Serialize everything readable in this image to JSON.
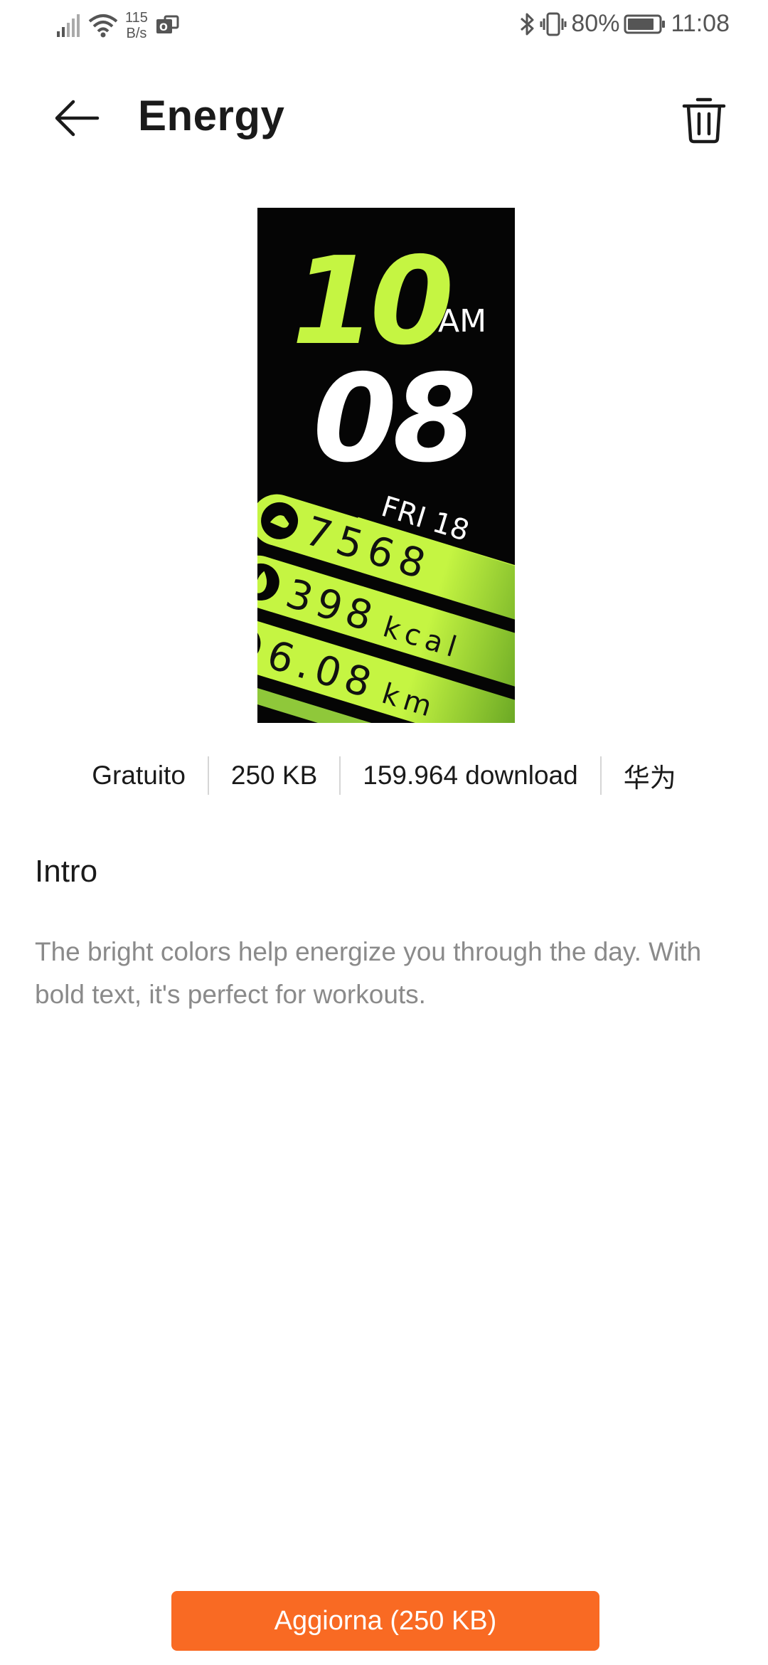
{
  "status_bar": {
    "speed_value": "115",
    "speed_unit": "B/s",
    "battery_percent": "80%",
    "time": "11:08"
  },
  "header": {
    "title": "Energy"
  },
  "watch_face": {
    "hour": "10",
    "ampm": "AM",
    "minute": "08",
    "date": "FRI 18",
    "steps": "7568",
    "calories": "398",
    "calories_unit": "kcal",
    "distance": "6.08",
    "distance_unit": "km",
    "accent_color": "#c5f542"
  },
  "meta": {
    "price": "Gratuito",
    "size": "250 KB",
    "downloads": "159.964 download",
    "author": "华为"
  },
  "intro": {
    "heading": "Intro",
    "text": "The bright colors help energize you through the day. With bold text, it's perfect for workouts."
  },
  "actions": {
    "update_label": "Aggiorna (250 KB)",
    "update_color": "#f96a23"
  }
}
